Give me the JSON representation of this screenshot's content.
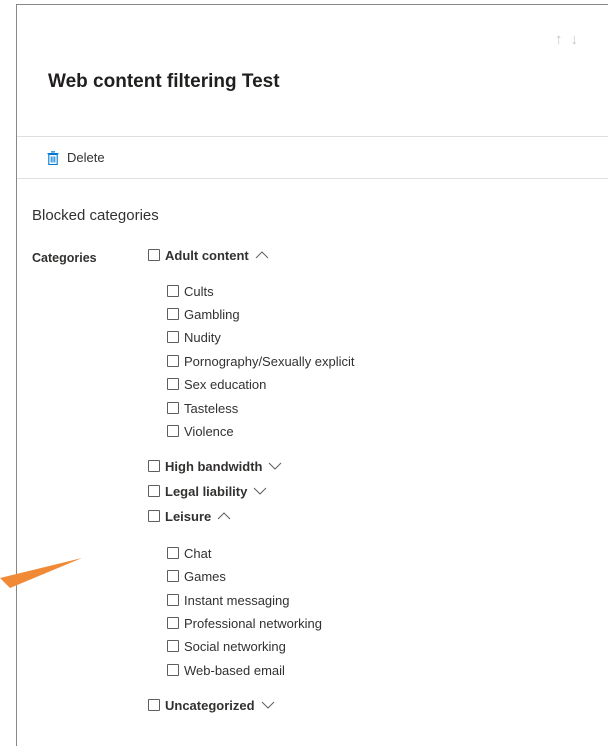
{
  "nav": {
    "up_glyph": "↑",
    "down_glyph": "↓"
  },
  "header": {
    "title": "Web content filtering Test"
  },
  "toolbar": {
    "delete_label": "Delete",
    "delete_icon": "trash-icon"
  },
  "section": {
    "title": "Blocked categories",
    "field_label": "Categories"
  },
  "categories": [
    {
      "label": "Adult content",
      "expanded": true,
      "children": [
        "Cults",
        "Gambling",
        "Nudity",
        "Pornography/Sexually explicit",
        "Sex education",
        "Tasteless",
        "Violence"
      ]
    },
    {
      "label": "High bandwidth",
      "expanded": false,
      "children": []
    },
    {
      "label": "Legal liability",
      "expanded": false,
      "children": []
    },
    {
      "label": "Leisure",
      "expanded": true,
      "children": [
        "Chat",
        "Games",
        "Instant messaging",
        "Professional networking",
        "Social networking",
        "Web-based email"
      ]
    },
    {
      "label": "Uncategorized",
      "expanded": false,
      "children": []
    }
  ],
  "colors": {
    "accent_annotation": "#f08a36",
    "border": "#8a8886",
    "divider": "#e1dfdd",
    "text": "#323130"
  }
}
